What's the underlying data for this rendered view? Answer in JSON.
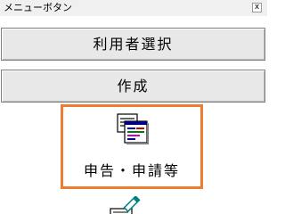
{
  "window": {
    "title": "メニューボタン",
    "close_symbol": "x"
  },
  "buttons": {
    "user_select": "利用者選択",
    "create": "作成"
  },
  "tools": [
    {
      "label": "申告・申請等",
      "icon": "report-form-icon",
      "selected": true,
      "highlight_color": "#ed7d31"
    }
  ],
  "partial_icon": "pencil-document-icon"
}
